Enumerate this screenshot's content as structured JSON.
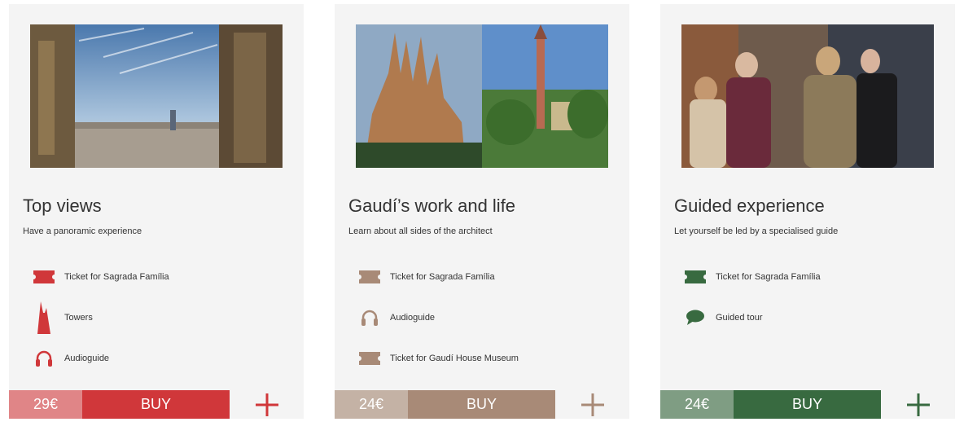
{
  "cards": [
    {
      "title": "Top views",
      "subtitle": "Have a panoramic experience",
      "features": [
        {
          "label": "Ticket for Sagrada Família",
          "icon": "ticket-icon"
        },
        {
          "label": "Towers",
          "icon": "towers-icon"
        },
        {
          "label": "Audioguide",
          "icon": "headphones-icon"
        }
      ],
      "price": "29€",
      "buy_label": "BUY",
      "colors": {
        "accent": "#d0373a",
        "light": "#e08587"
      }
    },
    {
      "title": "Gaudí’s work and life",
      "subtitle": "Learn about all sides of the architect",
      "features": [
        {
          "label": "Ticket for Sagrada Família",
          "icon": "ticket-icon"
        },
        {
          "label": "Audioguide",
          "icon": "headphones-icon"
        },
        {
          "label": "Ticket for Gaudí House Museum",
          "icon": "ticket-icon"
        }
      ],
      "price": "24€",
      "buy_label": "BUY",
      "colors": {
        "accent": "#a88a77",
        "light": "#c4b2a5"
      }
    },
    {
      "title": "Guided experience",
      "subtitle": "Let yourself be led by a specialised guide",
      "features": [
        {
          "label": "Ticket for Sagrada Família",
          "icon": "ticket-icon"
        },
        {
          "label": "Guided tour",
          "icon": "speech-bubble-icon"
        }
      ],
      "price": "24€",
      "buy_label": "BUY",
      "colors": {
        "accent": "#386a40",
        "light": "#7f9d83"
      }
    }
  ]
}
